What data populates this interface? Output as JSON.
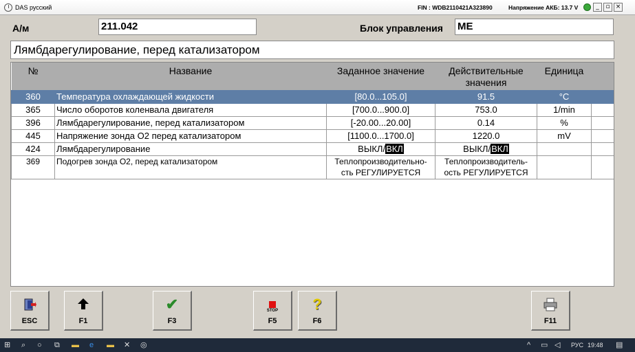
{
  "window": {
    "title": "DAS русский",
    "fin": "FIN : WDB2110421A323890",
    "battery": "Напряжение АКБ: 13.7 V"
  },
  "header": {
    "am_label": "A/м",
    "am_value": "211.042",
    "control_unit_label": "Блок управления",
    "control_unit_value": "ME",
    "title": "Лямбдарегулирование, перед катализатором"
  },
  "table": {
    "columns": [
      "№",
      "Название",
      "Заданное значение",
      "Действительные значения",
      "Единица"
    ],
    "rows": [
      {
        "num": "360",
        "name": "Температура охлаждающей жидкости",
        "target": "[80.0...105.0]",
        "actual": "91.5",
        "unit": "°C"
      },
      {
        "num": "365",
        "name": "Число оборотов коленвала двигателя",
        "target": "[700.0...900.0]",
        "actual": "753.0",
        "unit": "1/min"
      },
      {
        "num": "396",
        "name": "Лямбдарегулирование, перед катализатором",
        "target": "[-20.00...20.00]",
        "actual": "0.14",
        "unit": "%"
      },
      {
        "num": "445",
        "name": "Напряжение зонда O2 перед катализатором",
        "target": "[1100.0...1700.0]",
        "actual": "1220.0",
        "unit": "mV"
      },
      {
        "num": "424",
        "name": "Лямбдарегулирование",
        "target_off": "ВЫКЛ/",
        "target_on": "ВКЛ",
        "actual_off": "ВЫКЛ/",
        "actual_on": "ВКЛ",
        "unit": ""
      },
      {
        "num": "369",
        "name": "Подогрев зонда O2, перед катализатором",
        "target_l1": "Теплопроизводительно-",
        "target_l2": "сть РЕГУЛИРУЕТСЯ",
        "actual_l1": "Теплопроизводитель-",
        "actual_l2": "ость РЕГУЛИРУЕТСЯ",
        "unit": ""
      }
    ]
  },
  "buttons": {
    "esc": "ESC",
    "f1": "F1",
    "f3": "F3",
    "f5": "F5",
    "f5_stop": "STOP",
    "f6": "F6",
    "f11": "F11"
  },
  "taskbar": {
    "lang": "РУС",
    "time": "19:48"
  }
}
